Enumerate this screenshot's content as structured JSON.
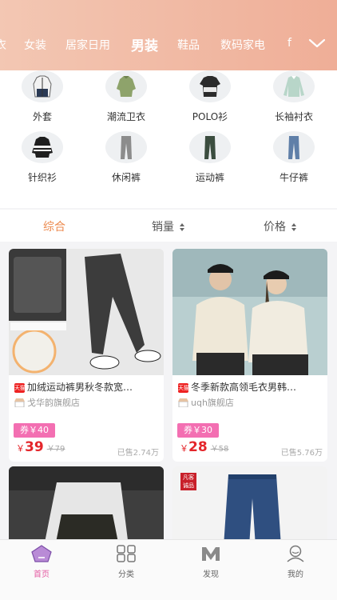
{
  "header": {
    "tabs": [
      {
        "label": "衣",
        "active": false
      },
      {
        "label": "女装",
        "active": false
      },
      {
        "label": "居家日用",
        "active": false
      },
      {
        "label": "男装",
        "active": true
      },
      {
        "label": "鞋品",
        "active": false
      },
      {
        "label": "数码家电",
        "active": false
      },
      {
        "label": "f",
        "active": false
      }
    ],
    "expand_icon": "chevron-down-icon"
  },
  "categories": [
    {
      "label": "外套",
      "icon": "jacket-image"
    },
    {
      "label": "潮流卫衣",
      "icon": "hoodie-image"
    },
    {
      "label": "POLO衫",
      "icon": "polo-shirt-image"
    },
    {
      "label": "长袖衬衣",
      "icon": "long-sleeve-shirt-image"
    },
    {
      "label": "针织衫",
      "icon": "knit-sweater-image"
    },
    {
      "label": "休闲裤",
      "icon": "casual-pants-image"
    },
    {
      "label": "运动裤",
      "icon": "sweatpants-image"
    },
    {
      "label": "牛仔裤",
      "icon": "jeans-image"
    }
  ],
  "sort": {
    "comprehensive": "综合",
    "sales": "销量",
    "price": "价格"
  },
  "products": [
    {
      "title": "加绒运动裤男秋冬款宽松束脚休闲裤",
      "title_visible": "加绒运动裤男秋冬款宽…",
      "platform_badge": "天猫",
      "shop": "戈华韵旗舰店",
      "coupon": "券￥40",
      "price_symbol": "￥",
      "price": "39",
      "original_price": "￥79",
      "sold": "已售2.74万"
    },
    {
      "title": "冬季新款高领毛衣男韩…",
      "title_visible": "冬季新款高领毛衣男韩…",
      "platform_badge": "天猫",
      "shop": "uqh旗舰店",
      "coupon": "券￥30",
      "price_symbol": "￥",
      "price": "28",
      "original_price": "￥58",
      "sold": "已售5.76万"
    },
    {
      "badge_text": "凡客诚品"
    },
    {}
  ],
  "bottom_nav": [
    {
      "label": "首页",
      "icon": "home-icon",
      "active": true
    },
    {
      "label": "分类",
      "icon": "grid-icon",
      "active": false
    },
    {
      "label": "发现",
      "icon": "discover-icon",
      "active": false
    },
    {
      "label": "我的",
      "icon": "user-icon",
      "active": false
    }
  ],
  "colors": {
    "header_start": "#f3c7b3",
    "header_end": "#efae97",
    "accent_orange": "#ec8a4e",
    "coupon_pink": "#f36fb2",
    "price_red": "#e4262b",
    "nav_active": "#e45aa2"
  }
}
